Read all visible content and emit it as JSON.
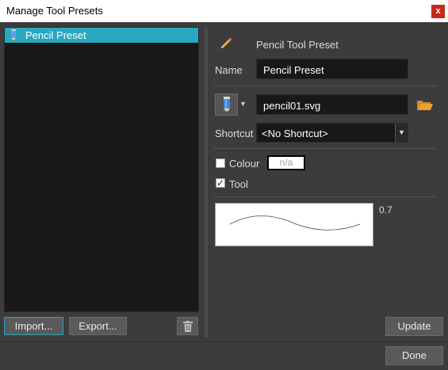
{
  "window": {
    "title": "Manage Tool Presets",
    "close_label": "x"
  },
  "preset_list": {
    "items": [
      {
        "label": "Pencil Preset",
        "icon": "pencil-icon",
        "selected": true
      }
    ]
  },
  "left_buttons": {
    "import": "Import...",
    "export": "Export...",
    "delete_icon": "trash-icon"
  },
  "details": {
    "header_icon": "pencil-icon",
    "header_label": "Pencil Tool Preset",
    "name_label": "Name",
    "name_value": "Pencil Preset",
    "tool_icon": "pencil-icon",
    "file_value": "pencil01.svg",
    "browse_icon": "folder-open-icon",
    "shortcut_label": "Shortcut",
    "shortcut_value": "<No Shortcut>",
    "colour_label": "Colour",
    "colour_checked": false,
    "colour_value": "n/a",
    "tool_label": "Tool",
    "tool_checked": true,
    "stroke_size": "0.7"
  },
  "footer": {
    "update": "Update",
    "done": "Done"
  },
  "colors": {
    "selection": "#2aa7c0",
    "background": "#3c3c3c",
    "close": "#c42b1c",
    "folder": "#f0a030"
  }
}
